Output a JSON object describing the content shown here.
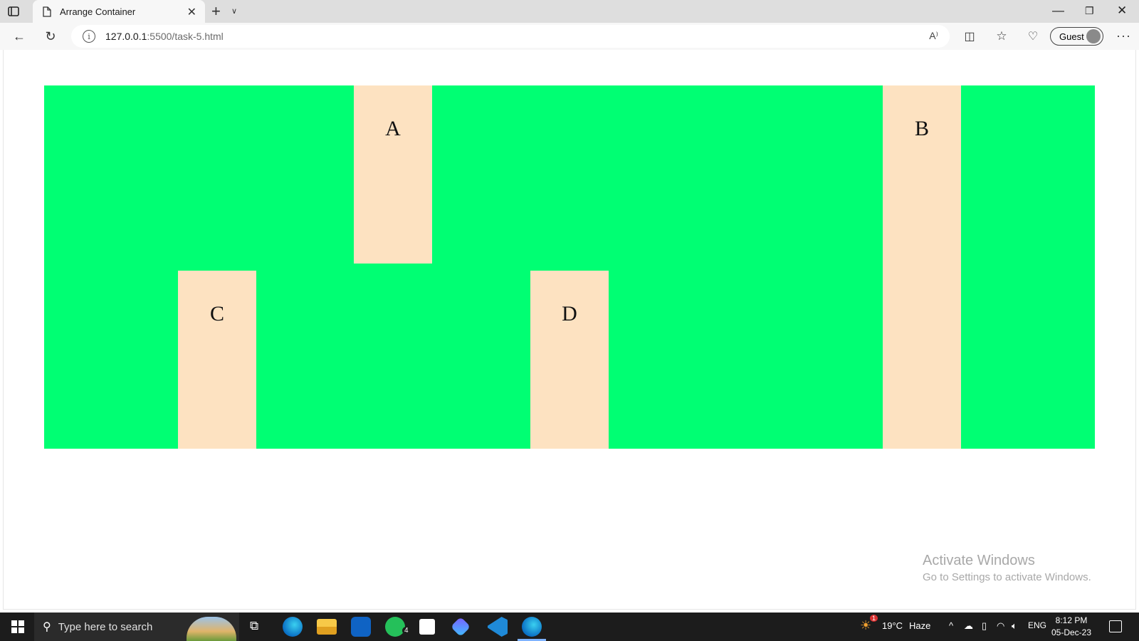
{
  "browser": {
    "tab_title": "Arrange Container",
    "url_host": "127.0.0.1",
    "url_rest": ":5500/task-5.html",
    "guest_label": "Guest"
  },
  "page": {
    "container_color": "#00ff73",
    "box_color": "#fde2c1",
    "boxes": {
      "a": "A",
      "b": "B",
      "c": "C",
      "d": "D"
    }
  },
  "watermark": {
    "title": "Activate Windows",
    "subtitle": "Go to Settings to activate Windows."
  },
  "taskbar": {
    "search_placeholder": "Type here to search",
    "whatsapp_badge": "4",
    "weather_temp": "19°C",
    "weather_desc": "Haze",
    "weather_badge": "1",
    "language": "ENG",
    "time": "8:12 PM",
    "date": "05-Dec-23"
  }
}
